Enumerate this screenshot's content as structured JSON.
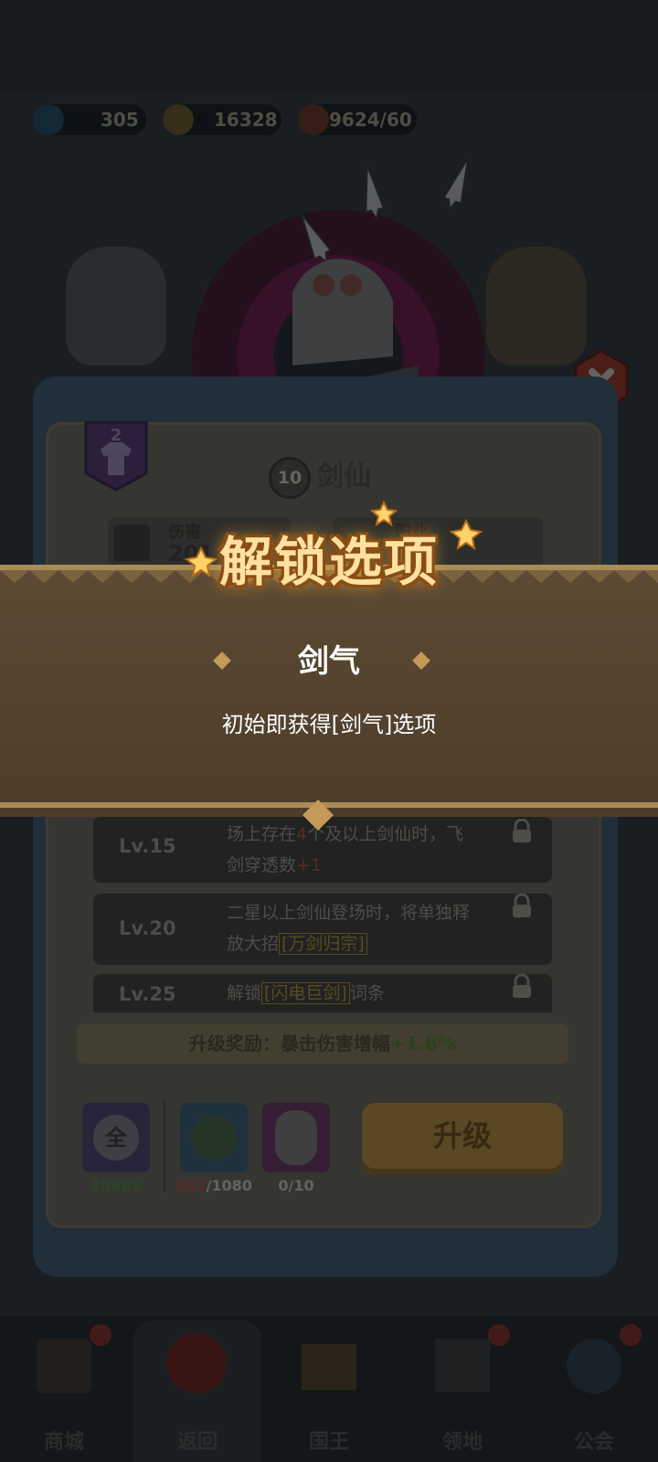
{
  "resources": {
    "gems": "305",
    "gold": "16328",
    "stamina": "9624/60"
  },
  "card": {
    "star_level": "2",
    "hero_level": "10",
    "hero_name": "剑仙",
    "stat_damage_label": "伤害",
    "stat_damage_value": "201",
    "stat_class_label": "职业"
  },
  "skills": [
    {
      "level": "Lv.15",
      "line1_a": "场上存在",
      "line1_num": "4",
      "line1_b": "个及以上剑仙时，飞",
      "line2_a": "剑穿透数",
      "line2_num": "+1"
    },
    {
      "level": "Lv.20",
      "line1": "二星以上剑仙登场时，将单独释",
      "line2_a": "放大招",
      "line2_tag": "[万剑归宗]"
    },
    {
      "level": "Lv.25",
      "line1_a": "解锁",
      "line1_tag": "[闪电巨剑]",
      "line1_b": "词条"
    }
  ],
  "reward": {
    "label": "升级奖励：暴击伤害增幅",
    "value": "+1.8%"
  },
  "costs": {
    "universal_shards": "10989",
    "hero_shards_have": "402",
    "hero_shards_need": "/1080",
    "hero_copies": "0/10",
    "universal_icon_char": "全"
  },
  "upgrade_button": "升级",
  "nav": {
    "item1": "商城",
    "item2": "返回",
    "item3": "国王",
    "item4": "领地",
    "item5": "公会"
  },
  "popup": {
    "title": "解锁选项",
    "option_name": "剑气",
    "option_desc": "初始即获得[剑气]选项"
  },
  "colors": {
    "banner": "#554530",
    "popup_title": "#ffe0a0",
    "highlight": "#7b6a2d"
  }
}
